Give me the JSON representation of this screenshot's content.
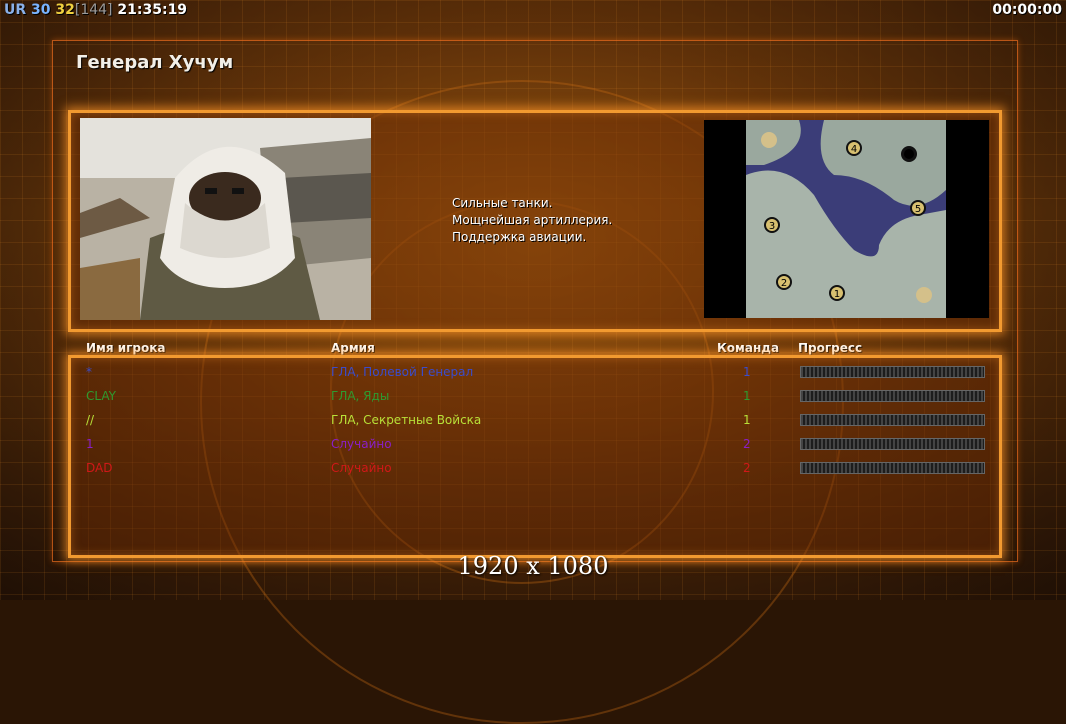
{
  "hud": {
    "ur": "UR",
    "n1": "30",
    "n2": "32",
    "n3": "[144]",
    "clock": "21:35:19",
    "timer": "00:00:00"
  },
  "general": {
    "title": "Генерал Хучум",
    "description": [
      "Сильные танки.",
      "Мощнейшая артиллерия.",
      "Поддержка авиации."
    ]
  },
  "map": {
    "start_positions": [
      "1",
      "2",
      "3",
      "4",
      "5"
    ]
  },
  "table": {
    "headers": {
      "name": "Имя игрока",
      "army": "Армия",
      "team": "Команда",
      "progress": "Прогресс"
    },
    "rows": [
      {
        "name": "*",
        "army": "ГЛА, Полевой Генерал",
        "team": "1",
        "color": "#3a4ccc"
      },
      {
        "name": "CLAY",
        "army": "ГЛА, Яды",
        "team": "1",
        "color": "#2f9a2f"
      },
      {
        "name": "//",
        "army": "ГЛА, Секретные Войска",
        "team": "1",
        "color": "#b8e038"
      },
      {
        "name": "1",
        "army": "Случайно",
        "team": "2",
        "color": "#8a1ec8"
      },
      {
        "name": "DAD",
        "army": "Случайно",
        "team": "2",
        "color": "#d01818"
      }
    ]
  },
  "resolution": "1920 x 1080"
}
